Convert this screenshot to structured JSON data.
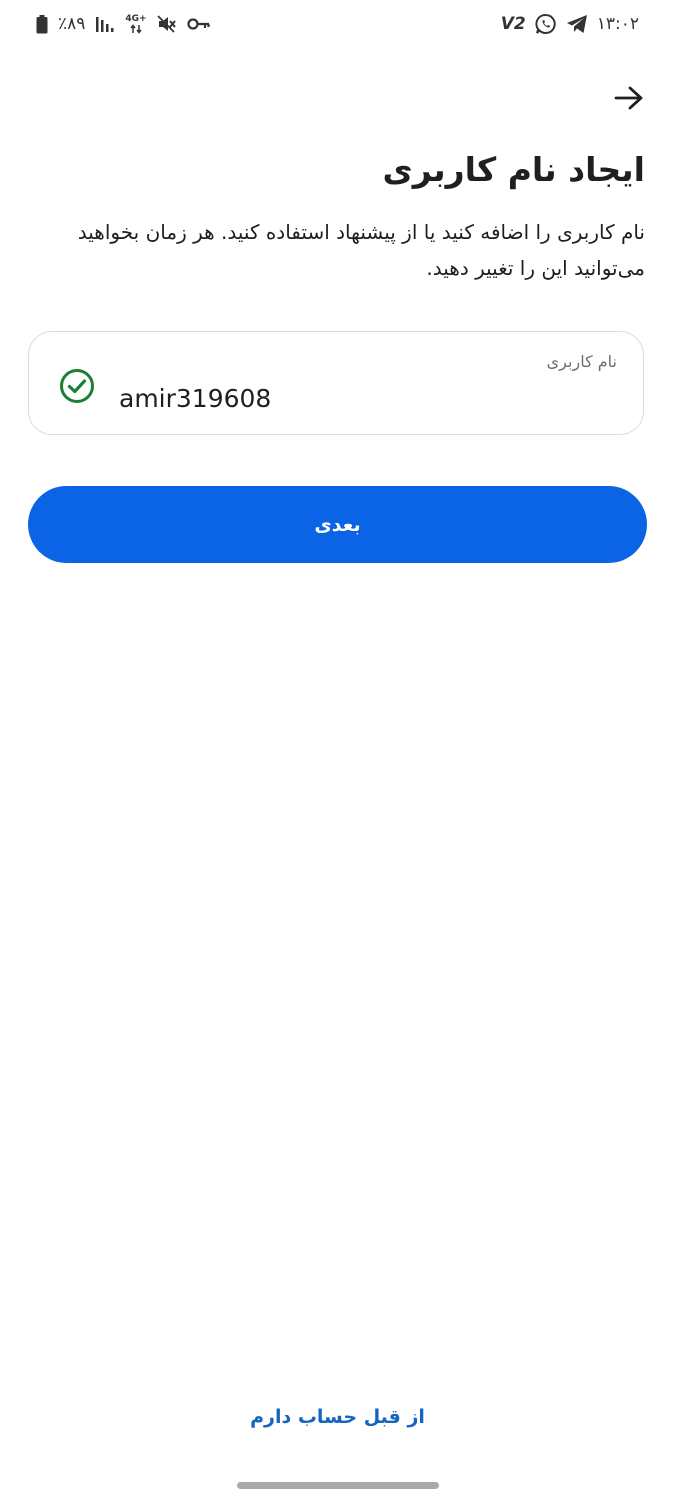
{
  "status_bar": {
    "time": "۱۳:۰۲",
    "vpn_label": "V2",
    "battery_percent": "٪۸۹",
    "network_type": "4G+",
    "icons": [
      "battery-icon",
      "signal-icon",
      "network-4g-icon",
      "mute-icon",
      "vpn-key-icon",
      "whatsapp-icon",
      "telegram-icon"
    ]
  },
  "header": {
    "back_icon": "arrow-right-icon"
  },
  "main": {
    "title": "ایجاد نام کاربری",
    "description": "نام کاربری را اضافه کنید یا از پیشنهاد استفاده کنید. هر زمان بخواهید می‌توانید این را تغییر دهید.",
    "username_field": {
      "label": "نام کاربری",
      "value": "amir319608",
      "status_icon": "check-circle-icon",
      "status_color": "#1e7e34"
    },
    "next_button": {
      "label": "بعدی",
      "color": "#0b63e5"
    }
  },
  "footer": {
    "existing_account_link": "از قبل حساب دارم",
    "link_color": "#1565c0"
  }
}
